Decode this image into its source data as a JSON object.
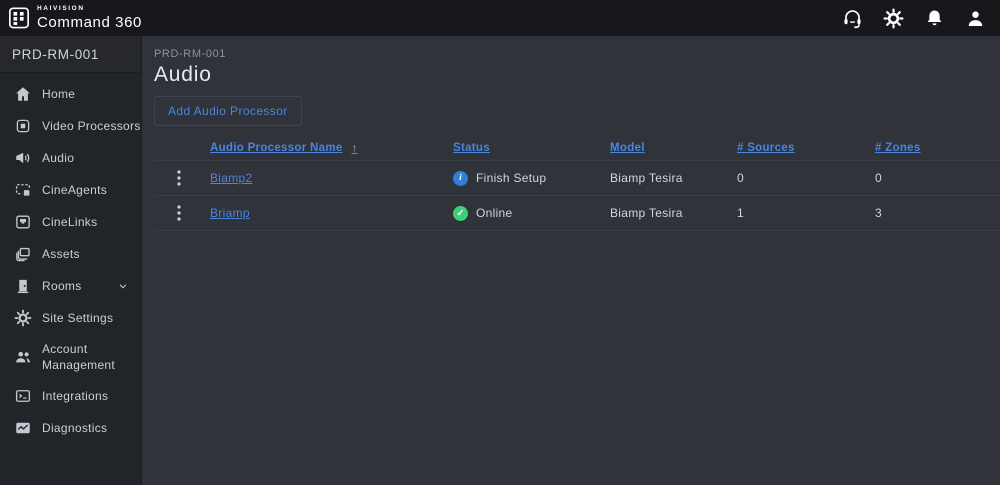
{
  "colors": {
    "accent_blue": "#4a85e0",
    "status_info_blue": "#2e7fd8",
    "status_online_green": "#3bd17a"
  },
  "topbar": {
    "brand_small": "HAIVISION",
    "brand_large": "Command 360",
    "icons": [
      {
        "id": "support-headset-icon"
      },
      {
        "id": "settings-gear-icon"
      },
      {
        "id": "notifications-bell-icon"
      },
      {
        "id": "user-avatar-icon"
      }
    ]
  },
  "sidebar": {
    "room_label": "PRD-RM-001",
    "items": [
      {
        "id": "home",
        "icon": "home-icon",
        "label": "Home"
      },
      {
        "id": "video-processors",
        "icon": "video-processors-icon",
        "label": "Video Processors"
      },
      {
        "id": "audio",
        "icon": "audio-icon",
        "label": "Audio"
      },
      {
        "id": "cineagents",
        "icon": "cineagents-icon",
        "label": "CineAgents"
      },
      {
        "id": "cinelinks",
        "icon": "cinelinks-icon",
        "label": "CineLinks"
      },
      {
        "id": "assets",
        "icon": "assets-icon",
        "label": "Assets"
      },
      {
        "id": "rooms",
        "icon": "rooms-icon",
        "label": "Rooms",
        "has_chevron": true
      },
      {
        "id": "site-settings",
        "icon": "site-settings-icon",
        "label": "Site Settings"
      },
      {
        "id": "account-management",
        "icon": "account-management-icon",
        "label": "Account Management",
        "wrap": true
      },
      {
        "id": "integrations",
        "icon": "integrations-icon",
        "label": "Integrations"
      },
      {
        "id": "diagnostics",
        "icon": "diagnostics-icon",
        "label": "Diagnostics"
      }
    ]
  },
  "main": {
    "breadcrumb": "PRD-RM-001",
    "title": "Audio",
    "add_button_label": "Add Audio Processor",
    "table": {
      "columns": [
        {
          "label": "Audio Processor Name",
          "sorted": "asc"
        },
        {
          "label": "Status"
        },
        {
          "label": "Model"
        },
        {
          "label": "# Sources"
        },
        {
          "label": "# Zones"
        }
      ],
      "sort_arrow": "↑",
      "rows": [
        {
          "name": "Biamp2",
          "status": {
            "label": "Finish Setup",
            "type": "info",
            "icon": "info-icon",
            "glyph": "i"
          },
          "model": "Biamp Tesira",
          "sources": "0",
          "zones": "0"
        },
        {
          "name": "Briamp",
          "status": {
            "label": "Online",
            "type": "online",
            "icon": "check-circle-icon",
            "glyph": "✓"
          },
          "model": "Biamp Tesira",
          "sources": "1",
          "zones": "3"
        }
      ]
    }
  }
}
